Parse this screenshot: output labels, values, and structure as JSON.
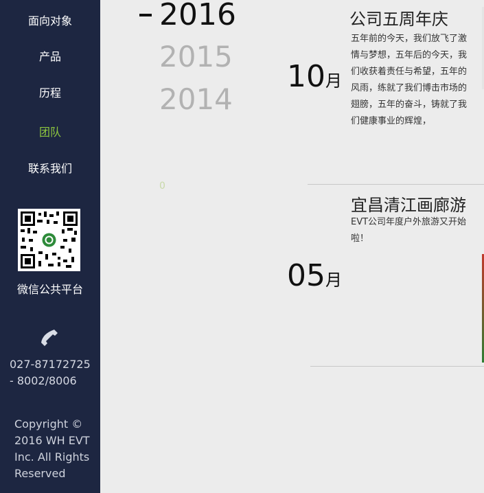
{
  "sidebar": {
    "nav": [
      {
        "label": "面向对象",
        "active": false
      },
      {
        "label": "产品",
        "active": false
      },
      {
        "label": "历程",
        "active": false
      },
      {
        "label": "团队",
        "active": true
      },
      {
        "label": "联系我们",
        "active": false
      }
    ],
    "wechat_label": "微信公共平台",
    "phone_line1": "027-87172725",
    "phone_line2": "- 8002/8006",
    "copyright_line1": "Copyright ©",
    "copyright_line2": "2016 WH EVT",
    "copyright_line3": "Inc. All Rights",
    "copyright_line4": "Reserved"
  },
  "timeline": {
    "years": [
      "2016",
      "2015",
      "2014"
    ],
    "current_year": "2016",
    "counter": "0"
  },
  "entries": [
    {
      "month_num": "10",
      "month_unit": "月",
      "title": "公司五周年庆",
      "body_lines": [
        "五年前的今天，我们放飞了激",
        "情与梦想，五年后的今天，我",
        "们收获着责任与希望，五年的",
        "风雨，练就了我们博击市场的",
        "翅膀，五年的奋斗，铸就了我",
        "们健康事业的辉煌，"
      ]
    },
    {
      "month_num": "05",
      "month_unit": "月",
      "title": "宜昌清江画廊游",
      "body_lines": [
        "EVT公司年度户外旅游又开始",
        "啦！"
      ]
    }
  ],
  "colors": {
    "sidebar_bg": "#1d2641",
    "active_nav": "#8dc63f",
    "page_bg": "#ececec"
  },
  "icons": [
    "qr-code-icon",
    "phone-icon"
  ]
}
